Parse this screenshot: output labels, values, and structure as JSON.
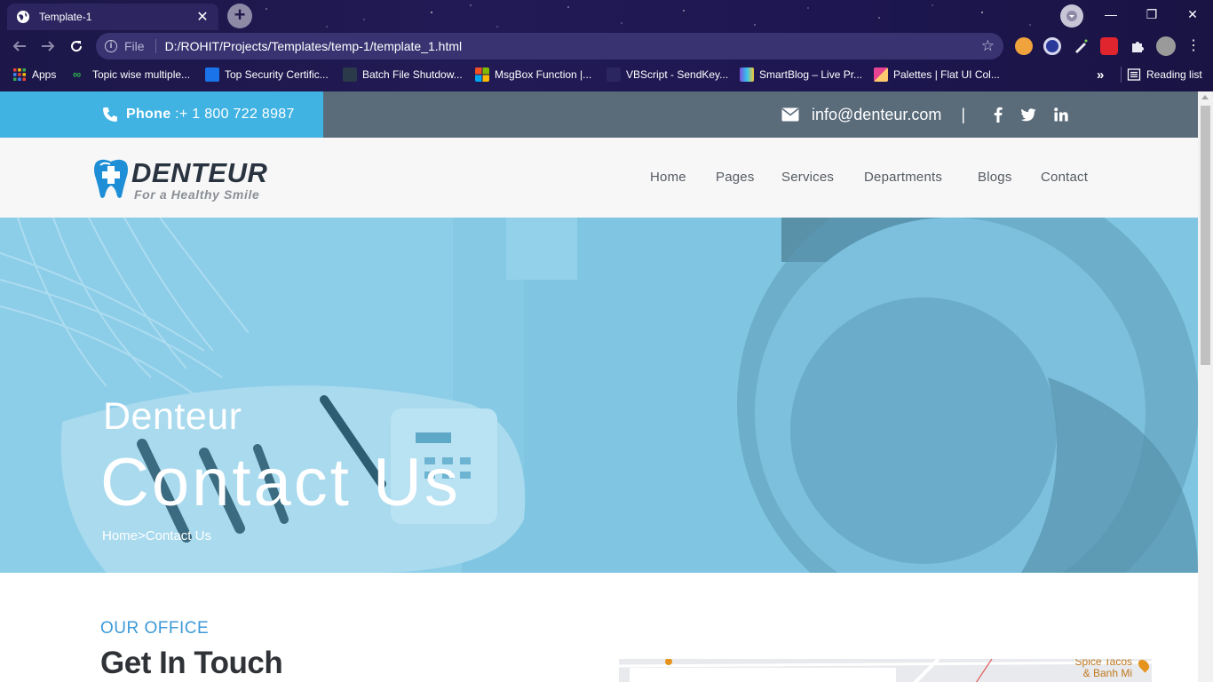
{
  "browser": {
    "tab_title": "Template-1",
    "tab_close": "✕",
    "new_tab": "+",
    "minimize": "—",
    "restore": "❐",
    "close": "✕",
    "file_label": "File",
    "url": "D:/ROHIT/Projects/Templates/temp-1/template_1.html",
    "bookmarks": [
      {
        "label": "Apps",
        "color": "#e94235"
      },
      {
        "label": "Topic wise multiple...",
        "color": "#2bb24c"
      },
      {
        "label": "Top Security Certific...",
        "color": "#1a73e8"
      },
      {
        "label": "Batch File Shutdow...",
        "color": "#2a3a4a"
      },
      {
        "label": "MsgBox Function |...",
        "color": "#f25022"
      },
      {
        "label": "VBScript - SendKey...",
        "color": "#3b3570"
      },
      {
        "label": "SmartBlog – Live Pr...",
        "color": "#7b4fd6"
      },
      {
        "label": "Palettes | Flat UI Col...",
        "color": "#e84393"
      }
    ],
    "more_bookmarks": "»",
    "reading_list": "Reading list"
  },
  "topbar": {
    "phone_label": "Phone",
    "phone_number": " :+ 1 800 722 8987",
    "email": "info@denteur.com",
    "separator": "|"
  },
  "logo": {
    "title": "DENTEUR",
    "tagline": "For a Healthy Smile"
  },
  "nav": {
    "items": [
      "Home",
      "Pages",
      "Services",
      "Departments",
      "Blogs",
      "Contact"
    ]
  },
  "hero": {
    "subtitle": "Denteur",
    "title": "Contact Us",
    "breadcrumb": "Home>Contact Us"
  },
  "section": {
    "label": "OUR OFFICE",
    "heading": "Get In Touch",
    "map_label": "Spice Tacos\n& Banh Mi"
  },
  "colors": {
    "topbar_accent": "#41b3e3",
    "topbar_bg": "#5a6b7a",
    "hero_overlay": "#7ec3e0",
    "section_label": "#3d9ad8"
  }
}
